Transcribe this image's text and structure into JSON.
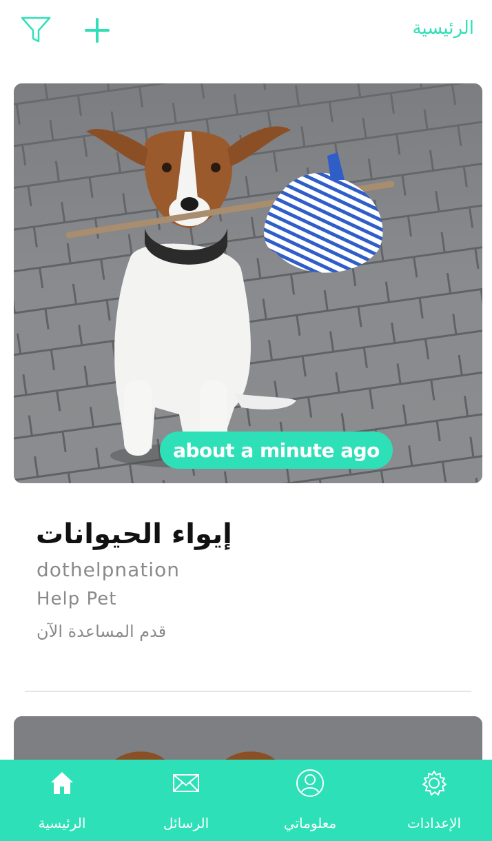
{
  "header": {
    "title": "الرئيسية",
    "filter_icon": "filter-icon",
    "add_icon": "plus-icon"
  },
  "post": {
    "time_ago": "about a minute ago",
    "title": "إيواء الحيوانات",
    "username": "dothelpnation",
    "category": "Help Pet",
    "description": "قدم المساعدة الآن"
  },
  "tabs": [
    {
      "label": "الرئيسية",
      "icon": "home-icon"
    },
    {
      "label": "الرسائل",
      "icon": "envelope-icon"
    },
    {
      "label": "معلوماتي",
      "icon": "user-icon"
    },
    {
      "label": "الإعدادات",
      "icon": "gear-icon"
    }
  ],
  "colors": {
    "accent": "#2ee0b8",
    "text_dark": "#111111",
    "text_muted": "#8a8a8a"
  }
}
